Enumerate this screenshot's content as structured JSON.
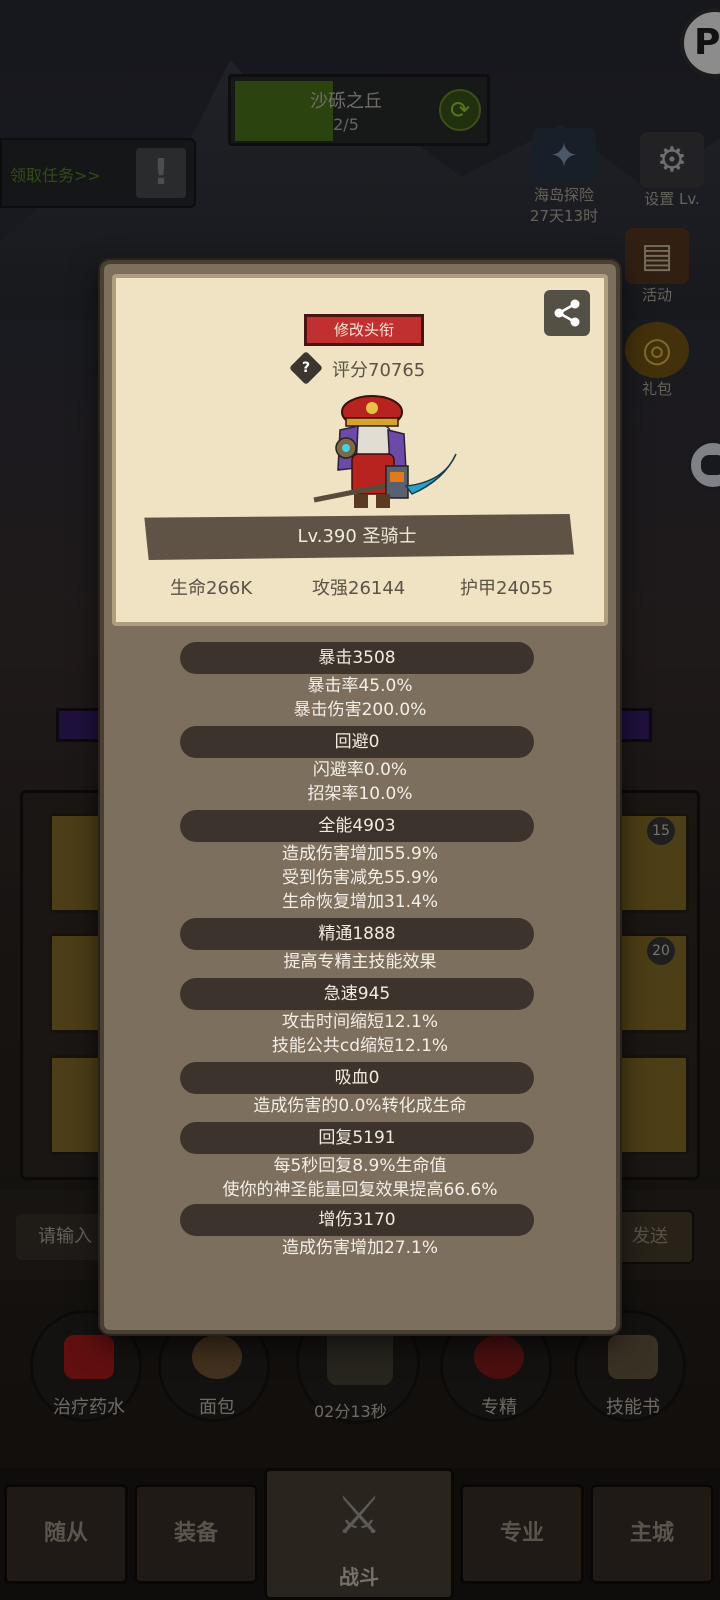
{
  "stage": {
    "name": "沙砾之丘",
    "progress_text": "2/5",
    "progress_fraction": 0.4
  },
  "quest": {
    "label": "领取任务>>"
  },
  "side_icons": [
    {
      "label": "海岛探险",
      "sub": "27天13时",
      "icon": "island-icon"
    },
    {
      "label": "设置 Lv.",
      "sub": "",
      "icon": "gear-icon"
    },
    {
      "label": "活动",
      "sub": "",
      "icon": "scroll-icon"
    },
    {
      "label": "礼包",
      "sub": "",
      "icon": "giftbag-icon"
    }
  ],
  "background_ui": {
    "slot_badges": [
      "15",
      "20"
    ],
    "input_placeholder": "请输入",
    "send_label": "发送"
  },
  "consumables": [
    {
      "label": "治疗药水",
      "icon": "potion-icon"
    },
    {
      "label": "面包",
      "icon": "bread-icon"
    },
    {
      "label": "02分13秒",
      "icon": "chest-icon"
    },
    {
      "label": "专精",
      "icon": "specialization-icon"
    },
    {
      "label": "技能书",
      "icon": "skillbook-icon"
    }
  ],
  "nav": {
    "followers": "随从",
    "equipment": "装备",
    "battle": "战斗",
    "profession": "专业",
    "main_city": "主城"
  },
  "profile": {
    "title_button": "修改头衔",
    "score": "评分70765",
    "level_class": "Lv.390 圣骑士",
    "hp": "生命266K",
    "attack": "攻强26144",
    "armor": "护甲24055"
  },
  "attributes": [
    {
      "head": "暴击3508",
      "lines": [
        "暴击率45.0%",
        "暴击伤害200.0%"
      ]
    },
    {
      "head": "回避0",
      "lines": [
        "闪避率0.0%",
        "招架率10.0%"
      ]
    },
    {
      "head": "全能4903",
      "lines": [
        "造成伤害增加55.9%",
        "受到伤害减免55.9%",
        "生命恢复增加31.4%"
      ]
    },
    {
      "head": "精通1888",
      "lines": [
        "提高专精主技能效果"
      ]
    },
    {
      "head": "急速945",
      "lines": [
        "攻击时间缩短12.1%",
        "技能公共cd缩短12.1%"
      ]
    },
    {
      "head": "吸血0",
      "lines": [
        "造成伤害的0.0%转化成生命"
      ]
    },
    {
      "head": "回复5191",
      "lines": [
        "每5秒回复8.9%生命值",
        "使你的神圣能量回复效果提高66.6%"
      ]
    },
    {
      "head": "增伤3170",
      "lines": [
        "造成伤害增加27.1%"
      ]
    }
  ]
}
